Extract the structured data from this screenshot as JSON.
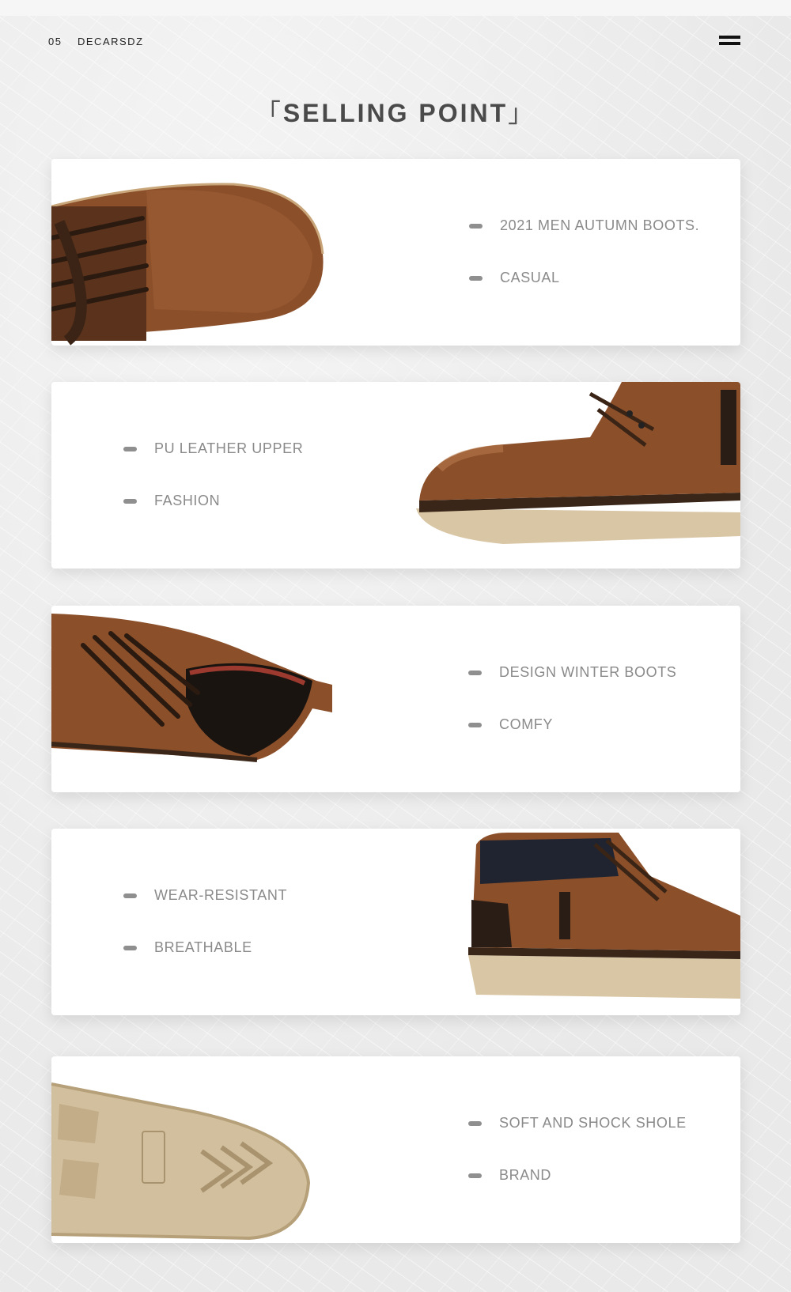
{
  "header": {
    "page_number": "05",
    "brand": "DECARSDZ",
    "menu_icon": "hamburger-menu-icon"
  },
  "title": {
    "left_bracket": "「",
    "text": "SELLING POINT",
    "right_bracket": "」"
  },
  "cards": [
    {
      "image": "boot-toe-top-view",
      "features": [
        "2021 MEN AUTUMN BOOTS.",
        "CASUAL"
      ]
    },
    {
      "image": "boot-side-view",
      "features": [
        "PU LEATHER UPPER",
        "FASHION"
      ]
    },
    {
      "image": "boot-collar-lining-view",
      "features": [
        "DESIGN WINTER BOOTS",
        "COMFY"
      ]
    },
    {
      "image": "boot-heel-side-view",
      "features": [
        "WEAR-RESISTANT",
        "BREATHABLE"
      ]
    },
    {
      "image": "boot-outsole-view",
      "features": [
        "SOFT AND SHOCK SHOLE",
        "BRAND"
      ]
    }
  ],
  "colors": {
    "leather": "#8b4f2a",
    "sole": "#d9c6a5",
    "text_gray": "#8a8a8a"
  }
}
